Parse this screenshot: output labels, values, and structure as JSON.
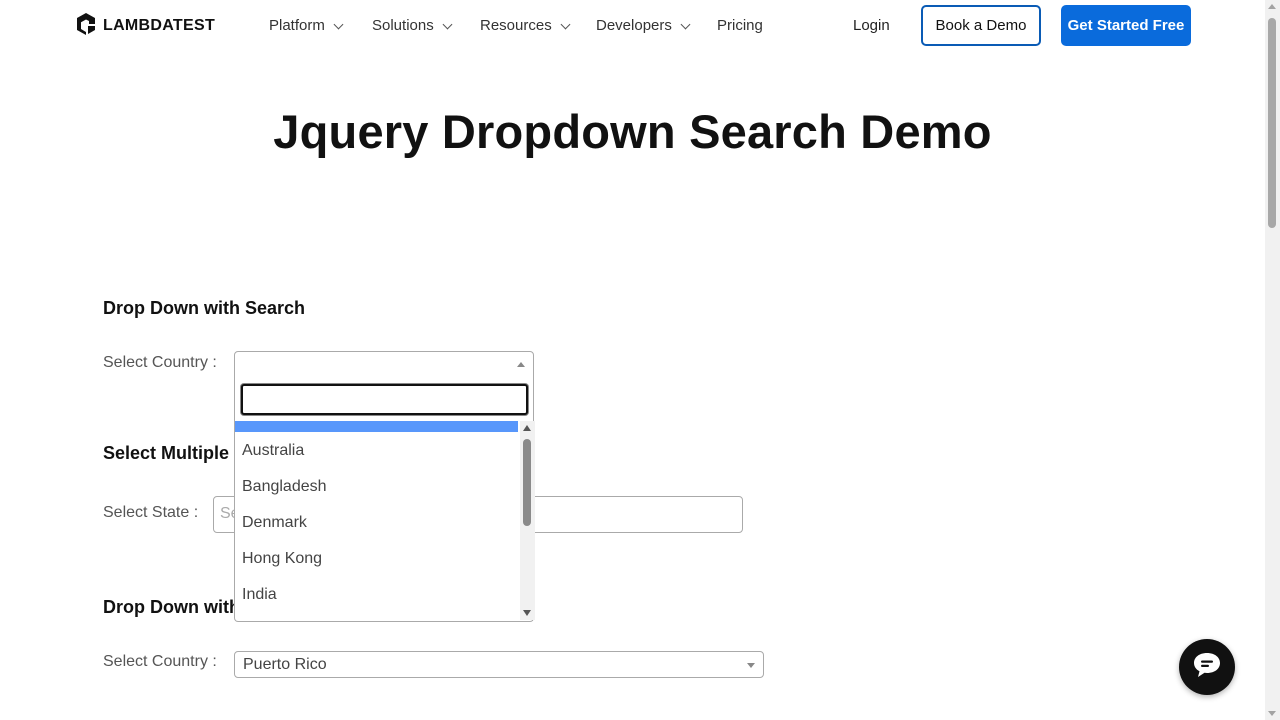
{
  "nav": {
    "logo_text": "LAMBDATEST",
    "items": [
      {
        "label": "Platform",
        "has_menu": true
      },
      {
        "label": "Solutions",
        "has_menu": true
      },
      {
        "label": "Resources",
        "has_menu": true
      },
      {
        "label": "Developers",
        "has_menu": true
      },
      {
        "label": "Pricing",
        "has_menu": false
      }
    ],
    "login": "Login",
    "book_demo": "Book a Demo",
    "get_started": "Get Started Free"
  },
  "page": {
    "title": "Jquery Dropdown Search Demo"
  },
  "section1": {
    "title": "Drop Down with Search",
    "label": "Select Country :",
    "selected": "",
    "dropdown_open": true,
    "search_value": "",
    "options": [
      "Australia",
      "Bangladesh",
      "Denmark",
      "Hong Kong",
      "India"
    ]
  },
  "section2": {
    "title": "Select Multiple Values with Search",
    "label": "Select State :",
    "placeholder": "Select state(s)"
  },
  "section3": {
    "title": "Drop Down with Disabled Values",
    "label": "Select Country :",
    "selected": "Puerto Rico"
  },
  "colors": {
    "primary": "#0a6bdc",
    "highlight": "#5897fb",
    "text": "#111111"
  }
}
